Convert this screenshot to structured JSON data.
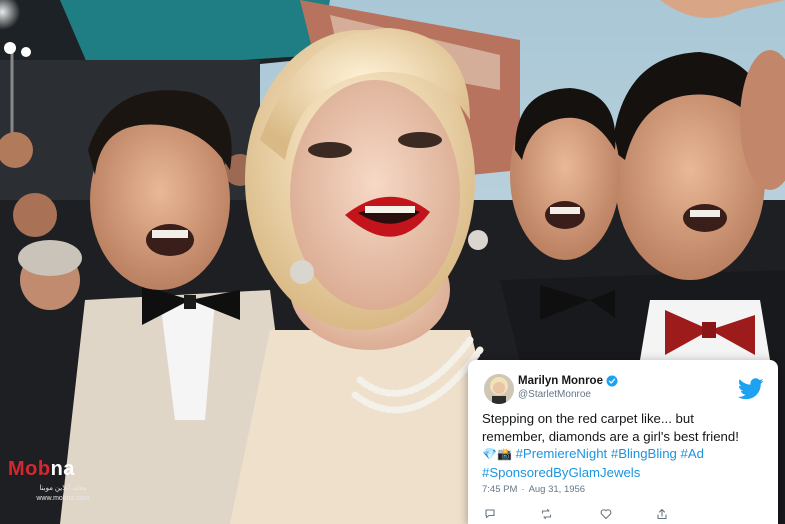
{
  "scene": {
    "description_icon": "photo-scene"
  },
  "tweet": {
    "display_name": "Marilyn Monroe",
    "handle": "@StarletMonroe",
    "verified_icon": "verified-badge-icon",
    "platform_icon": "twitter-bird-icon",
    "text_line1": "Stepping on the red carpet like... but",
    "text_line2": "remember, diamonds are a girl's best friend!",
    "emoji1": "💎",
    "emoji2": "📸",
    "hashtag1": "#PremiereNight",
    "hashtag2": "#BlingBling",
    "hashtag3": "#Ad",
    "hashtag4": "#SponsoredByGlamJewels",
    "time": "7:45 PM",
    "separator": "·",
    "date": "Aug 31, 1956",
    "colors": {
      "link": "#1b95e0",
      "brand": "#1da1f2",
      "text": "#14171a",
      "muted": "#657786"
    }
  },
  "watermark": {
    "logo_part1": "Mob",
    "logo_part2": "na",
    "subtitle": "مجله آنلاین موبنا",
    "url": "www.mobna.com"
  }
}
